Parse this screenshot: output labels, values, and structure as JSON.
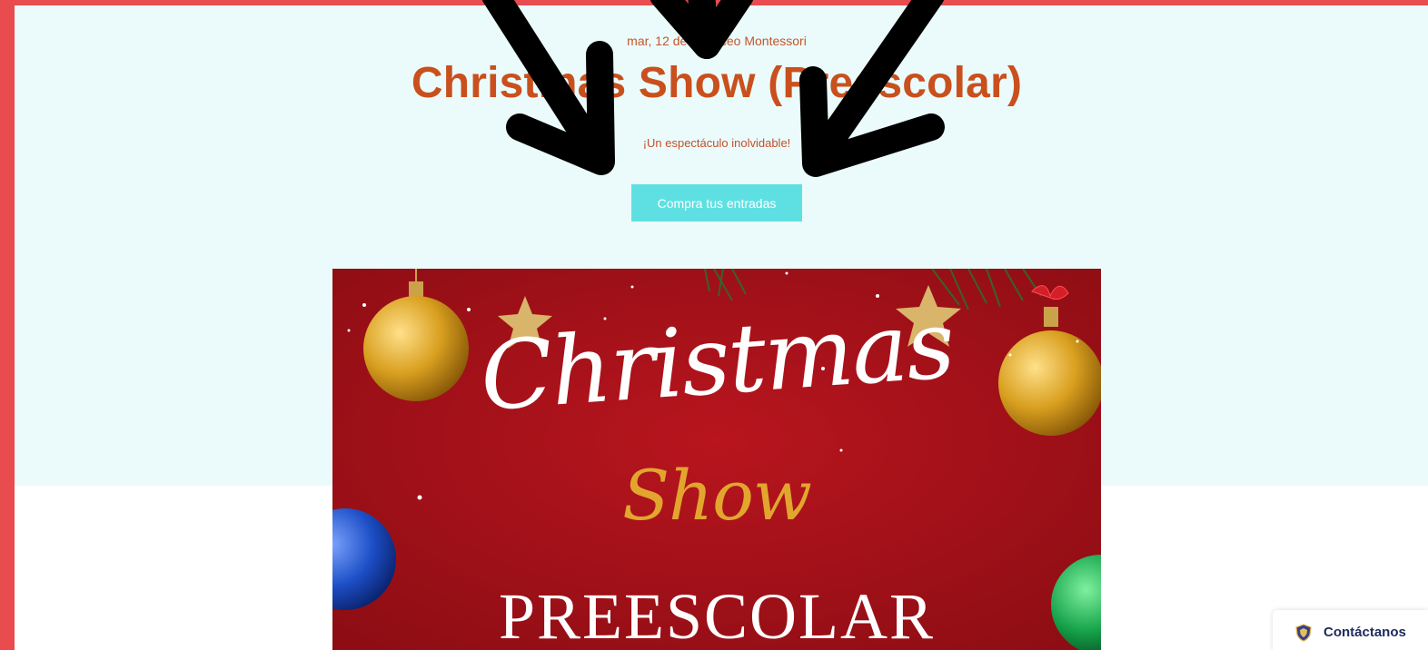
{
  "event": {
    "meta": "mar, 12 de dic   Liceo Montessori",
    "title": "Christmas Show (Preescolar)",
    "subtitle": "¡Un espectáculo inolvidable!",
    "buy_button": "Compra tus entradas"
  },
  "poster": {
    "line1": "Christmas",
    "line2": "Show",
    "line3": "PREESCOLAR"
  },
  "contact_widget": {
    "label": "Contáctanos",
    "icon": "shield-crest-icon"
  },
  "colors": {
    "frame": "#e84c4e",
    "hero_bg": "#ebfbfb",
    "title": "#c9501d",
    "button": "#5ee0e3",
    "poster_bg": "#a6121a",
    "show_gold": "#e2a62e"
  }
}
